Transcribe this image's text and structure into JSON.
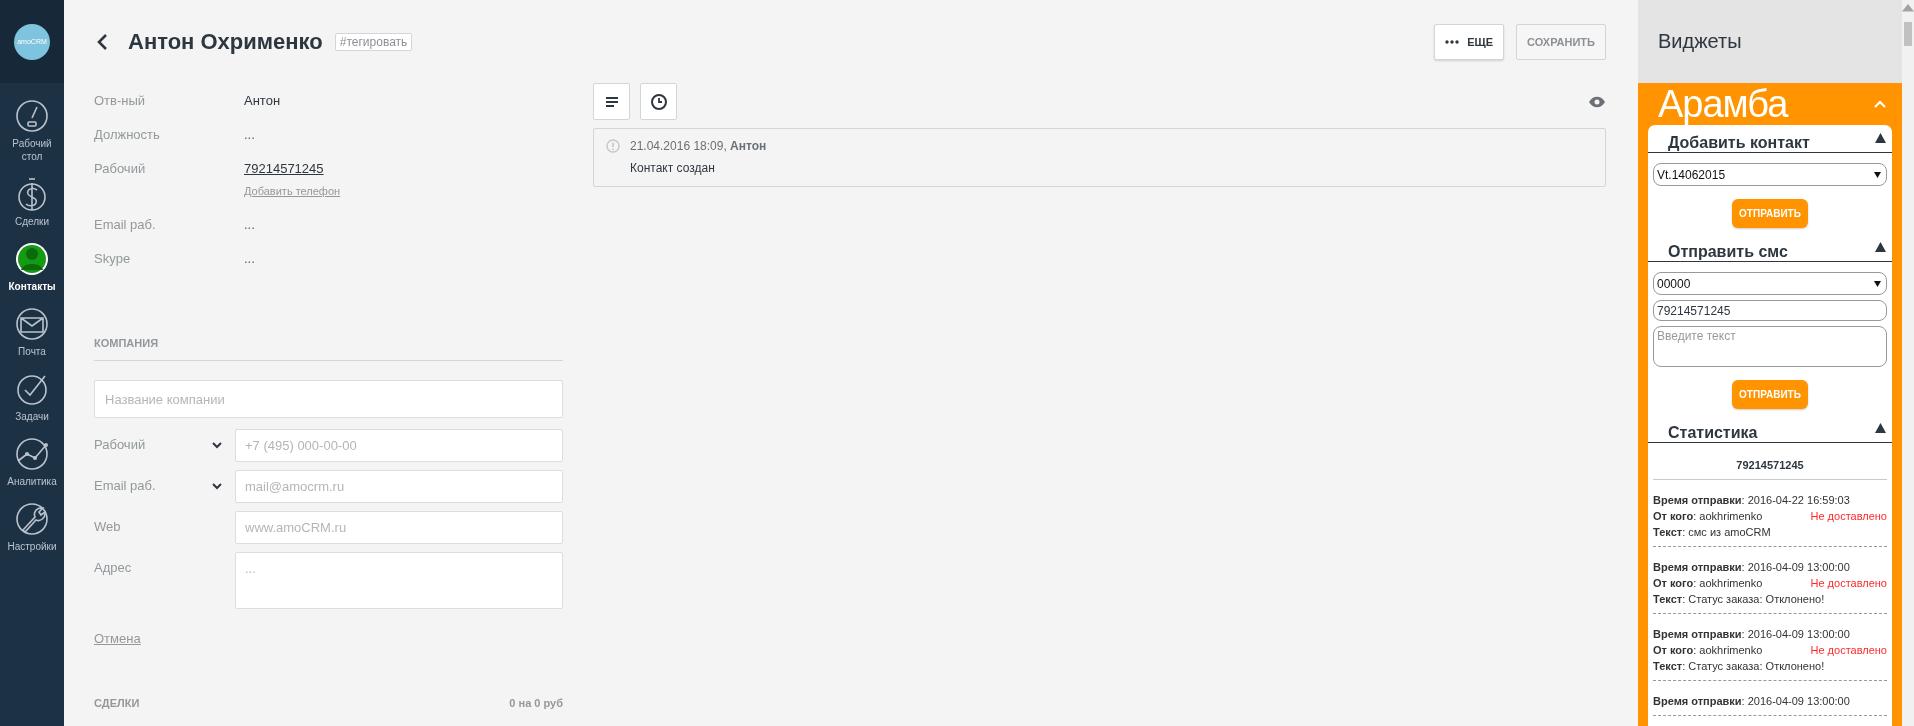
{
  "sidebar": {
    "logo": "amoCRM",
    "items": [
      {
        "label": "Рабочий стол",
        "kind": "dashboard",
        "selected": false
      },
      {
        "label": "Сделки",
        "kind": "dollar",
        "selected": false
      },
      {
        "label": "Контакты",
        "kind": "person",
        "selected": true
      },
      {
        "label": "Почта",
        "kind": "mail",
        "selected": false
      },
      {
        "label": "Задачи",
        "kind": "check",
        "selected": false
      },
      {
        "label": "Аналитика",
        "kind": "chart",
        "selected": false
      },
      {
        "label": "Настройки",
        "kind": "wrench",
        "selected": false
      }
    ]
  },
  "header": {
    "title": "Антон Охрименко",
    "tag": "#тегировать",
    "buttons": [
      {
        "label": "ЕЩЕ",
        "kind": "more"
      },
      {
        "label": "СОХРАНИТЬ",
        "kind": "save"
      }
    ]
  },
  "fields": [
    {
      "label": "Отв-ный",
      "value": "Антон",
      "kind": "text"
    },
    {
      "label": "Должность",
      "value": "...",
      "kind": "empty"
    },
    {
      "label": "Рабочий",
      "value": "79214571245",
      "kind": "link",
      "add_link": "Добавить телефон"
    },
    {
      "label": "Email раб.",
      "value": "...",
      "kind": "empty"
    },
    {
      "label": "Skype",
      "value": "...",
      "kind": "empty"
    }
  ],
  "company": {
    "heading": "КОМПАНИЯ",
    "name_placeholder": "Название компании",
    "rows": [
      {
        "label": "Рабочий",
        "dropdown": true,
        "placeholder": "+7 (495) 000-00-00",
        "kind": "input"
      },
      {
        "label": "Email раб.",
        "dropdown": true,
        "placeholder": "mail@amocrm.ru",
        "kind": "input"
      },
      {
        "label": "Web",
        "dropdown": false,
        "placeholder": "www.amoCRM.ru",
        "kind": "input"
      },
      {
        "label": "Адрес",
        "dropdown": false,
        "placeholder": "...",
        "kind": "textarea"
      }
    ],
    "cancel": "Отмена"
  },
  "deals": {
    "heading": "СДЕЛКИ",
    "summary": "0 на 0 руб"
  },
  "feed": {
    "tools": [
      {
        "kind": "list"
      },
      {
        "kind": "clock"
      }
    ],
    "entries": [
      {
        "meta": "21.04.2016 18:09, **Антон**",
        "text": "Контакт создан"
      }
    ]
  },
  "widgets": {
    "title": "Виджеты",
    "brand": "Арамба",
    "expanded": true,
    "sections": [
      {
        "kind": "contact",
        "title": "Добавить контакт",
        "expanded": true,
        "select": "Vt.14062015",
        "button": "ОТПРАВИТЬ"
      },
      {
        "kind": "sms",
        "title": "Отправить смс",
        "expanded": true,
        "select": "00000",
        "phone": "79214571245",
        "text_placeholder": "Введите текст",
        "button": "ОТПРАВИТЬ"
      },
      {
        "kind": "stats",
        "title": "Статистика",
        "expanded": true,
        "number": "79214571245",
        "entries": [
          {
            "lines": [
              "**Время отправки**: 2016-04-22 16:59:03",
              "**От кого**: aokhrimenko",
              "**Текст**: смс из amoCRM"
            ],
            "status": "Не доставлено",
            "color": "#ff2a2a"
          },
          {
            "lines": [
              "**Время отправки**: 2016-04-09 13:00:00",
              "**От кого**: aokhrimenko",
              "**Текст**: Статус заказа: Отклонено!"
            ],
            "status": "Не доставлено",
            "color": "#ff2a2a"
          },
          {
            "lines": [
              "**Время отправки**: 2016-04-09 13:00:00",
              "**От кого**: aokhrimenko",
              "**Текст**: Статус заказа: Отклонено!"
            ],
            "status": "Не доставлено",
            "color": "#ff2a2a"
          },
          {
            "lines": [
              "**Время отправки**: 2016-04-09 13:00:00"
            ]
          }
        ]
      }
    ]
  }
}
